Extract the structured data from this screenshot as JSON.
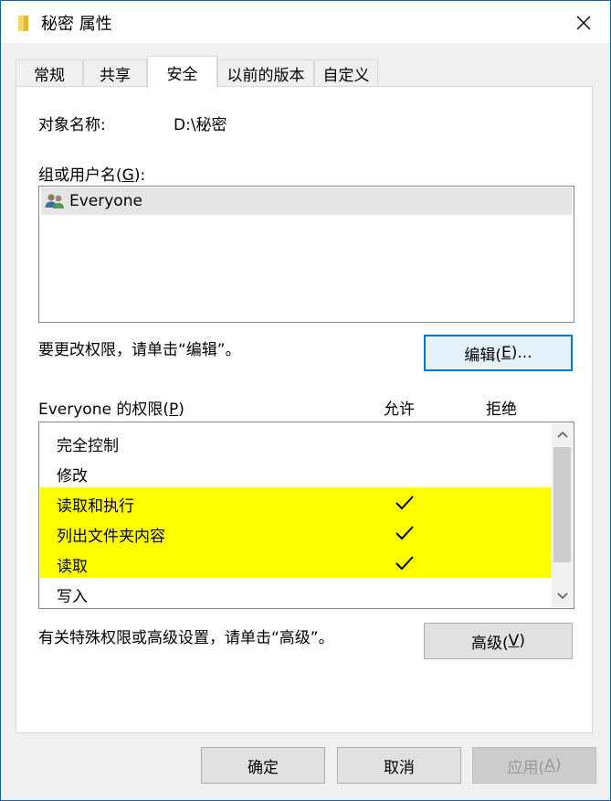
{
  "window": {
    "title": "秘密 属性",
    "folder_icon": "folder-icon",
    "close_icon": "close-icon"
  },
  "tabs": [
    {
      "label": "常规",
      "active": false
    },
    {
      "label": "共享",
      "active": false
    },
    {
      "label": "安全",
      "active": true
    },
    {
      "label": "以前的版本",
      "active": false
    },
    {
      "label": "自定义",
      "active": false
    }
  ],
  "security": {
    "object_name_label": "对象名称:",
    "object_name_value": "D:\\秘密",
    "group_label_prefix": "组或用户名(",
    "group_label_key": "G",
    "group_label_suffix": "):",
    "users": [
      {
        "name": "Everyone",
        "icon": "users-group-icon"
      }
    ],
    "edit_hint": "要更改权限，请单击“编辑”。",
    "edit_button_prefix": "编辑(",
    "edit_button_key": "E",
    "edit_button_suffix": ")...",
    "perm_label_prefix": "Everyone 的权限(",
    "perm_label_key": "P",
    "perm_label_suffix": ")",
    "allow_header": "允许",
    "deny_header": "拒绝",
    "permissions": [
      {
        "name": "完全控制",
        "allow": false,
        "highlighted": false
      },
      {
        "name": "修改",
        "allow": false,
        "highlighted": false
      },
      {
        "name": "读取和执行",
        "allow": true,
        "highlighted": true
      },
      {
        "name": "列出文件夹内容",
        "allow": true,
        "highlighted": true
      },
      {
        "name": "读取",
        "allow": true,
        "highlighted": true
      },
      {
        "name": "写入",
        "allow": false,
        "highlighted": false
      }
    ],
    "advanced_hint": "有关特殊权限或高级设置，请单击“高级”。",
    "advanced_button_prefix": "高级(",
    "advanced_button_key": "V",
    "advanced_button_suffix": ")"
  },
  "footer": {
    "ok_label": "确定",
    "cancel_label": "取消",
    "apply_prefix": "应用(",
    "apply_key": "A",
    "apply_suffix": ")"
  },
  "colors": {
    "highlight": "#ffff00",
    "window_border": "#0a64b6",
    "focus_border": "#0078d7"
  }
}
